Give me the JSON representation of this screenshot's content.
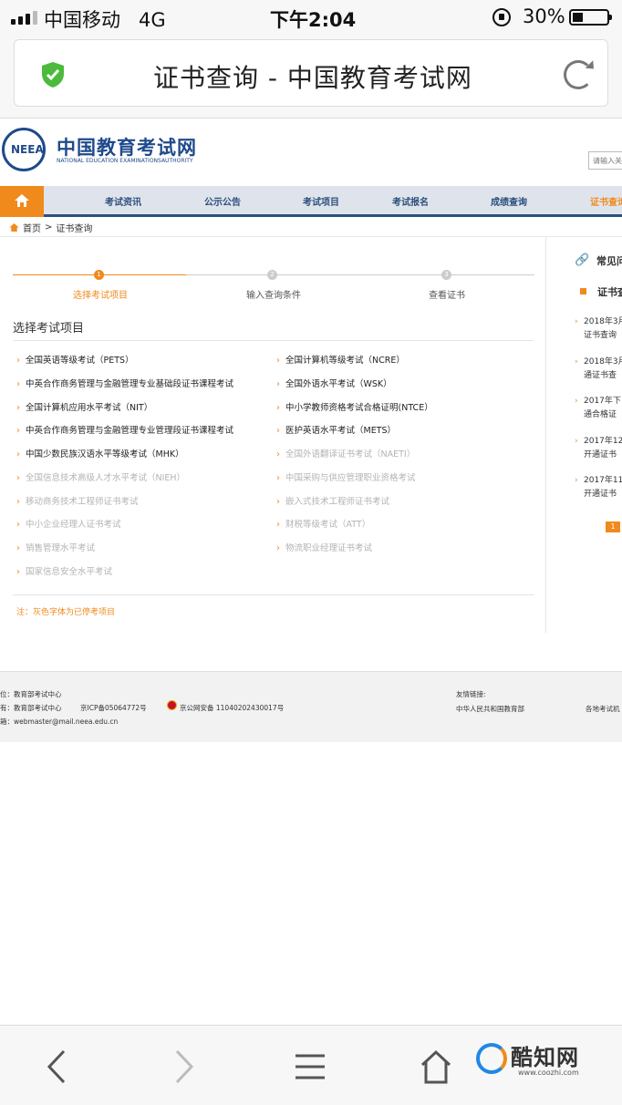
{
  "status_bar": {
    "carrier": "中国移动",
    "network": "4G",
    "time": "下午2:04",
    "battery": "30%"
  },
  "browser": {
    "page_title": "证书查询 - 中国教育考试网"
  },
  "site": {
    "logo_title": "中国教育考试网",
    "logo_subtitle": "NATIONAL EDUCATION EXAMINATIONSAUTHORITY",
    "logo_mark": "NEEA",
    "search_placeholder": "请输入关键字"
  },
  "nav": {
    "items": [
      {
        "label": "考试资讯"
      },
      {
        "label": "公示公告"
      },
      {
        "label": "考试项目"
      },
      {
        "label": "考试报名"
      },
      {
        "label": "成绩查询"
      },
      {
        "label": "证书查询"
      }
    ]
  },
  "breadcrumb": {
    "home": "首页",
    "sep": ">",
    "current": "证书查询"
  },
  "steps": [
    {
      "num": "1",
      "label": "选择考试项目"
    },
    {
      "num": "2",
      "label": "输入查询条件"
    },
    {
      "num": "3",
      "label": "查看证书"
    }
  ],
  "section_title": "选择考试项目",
  "exams_left": [
    "全国英语等级考试（PETS）",
    "中英合作商务管理与金融管理专业基础段证书课程考试",
    "全国计算机应用水平考试（NIT）",
    "中英合作商务管理与金融管理专业管理段证书课程考试",
    "中国少数民族汉语水平等级考试（MHK）",
    "全国信息技术高级人才水平考试（NIEH）",
    "移动商务技术工程师证书考试",
    "中小企业经理人证书考试",
    "销售管理水平考试",
    "国家信息安全水平考试"
  ],
  "exams_right": [
    "全国计算机等级考试（NCRE）",
    "全国外语水平考试（WSK）",
    "中小学教师资格考试合格证明(NTCE）",
    "医护英语水平考试（METS）",
    "全国外语翻译证书考试（NAETI）",
    "中国采购与供应管理职业资格考试",
    "嵌入式技术工程师证书考试",
    "财税等级考试（ATT）",
    "物流职业经理证书考试"
  ],
  "note": "注：灰色字体为已停考项目",
  "sidebar": {
    "heading1": "常见问",
    "heading2": "证书查",
    "items": [
      {
        "line1": "2018年3月",
        "line2": "证书查询"
      },
      {
        "line1": "2018年3月",
        "line2": "通证书查"
      },
      {
        "line1": "2017年下",
        "line2": "通合格证"
      },
      {
        "line1": "2017年12",
        "line2": "开通证书"
      },
      {
        "line1": "2017年11",
        "line2": "开通证书"
      }
    ],
    "page": "1"
  },
  "footer": {
    "r1": "位：教育部考试中心",
    "r2a": "有：教育部考试中心",
    "r2b": "京ICP备05064772号",
    "r2c": "京公网安备 11040202430017号",
    "r3": "箱：webmaster@mail.neea.edu.cn",
    "links_label": "友情链接:",
    "link1": "中华人民共和国教育部",
    "link2": "各地考试机"
  },
  "watermark": {
    "name": "酷知网",
    "url": "www.coozhi.com"
  },
  "colors": {
    "accent": "#f08a1c",
    "brand": "#1f4a8b",
    "nav_bg": "#dfe4ec",
    "shield": "#4cbb3c"
  }
}
